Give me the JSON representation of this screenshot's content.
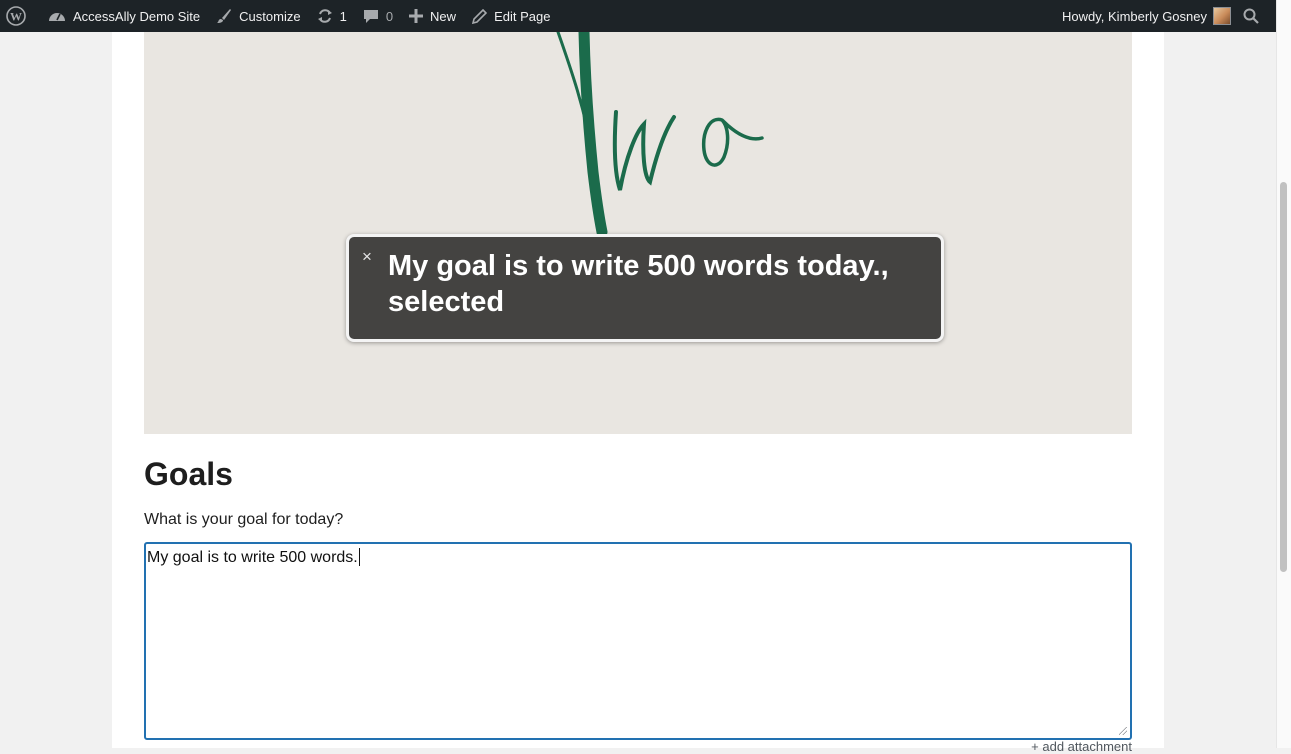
{
  "admin_bar": {
    "site_name": "AccessAlly Demo Site",
    "customize_label": "Customize",
    "updates_count": "1",
    "comments_count": "0",
    "new_label": "New",
    "edit_page_label": "Edit Page",
    "greeting": "Howdy, Kimberly Gosney"
  },
  "hero": {
    "script_text": "Two",
    "ink_color": "#1b6b4b"
  },
  "goals": {
    "heading": "Goals",
    "question": "What is your goal for today?",
    "answer_value": "My goal is to write 500 words.",
    "attachment_link": "+ add attachment"
  },
  "voiceover": {
    "close_symbol": "×",
    "caption": "My goal is to write 500 words today., selected"
  },
  "colors": {
    "admin_bar_bg": "#1d2327",
    "focus_border": "#2271b1",
    "caption_bg": "#444341"
  }
}
